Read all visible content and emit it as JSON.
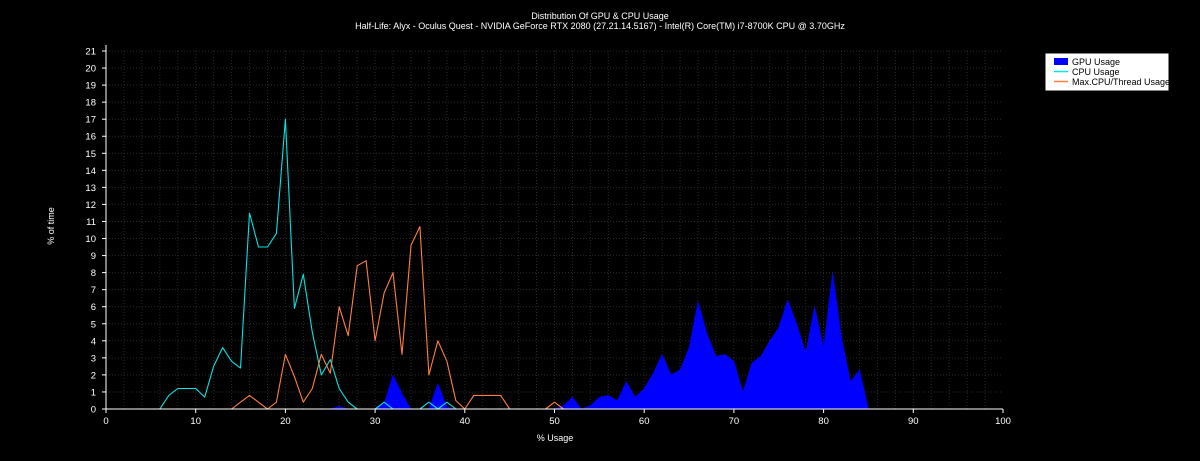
{
  "chart_data": {
    "type": "area",
    "title": "Distribution Of GPU & CPU Usage",
    "subtitle": "Half-Life: Alyx - Oculus Quest - NVIDIA GeForce RTX 2080 (27.21.14.5167) - Intel(R) Core(TM) i7-8700K CPU @ 3.70GHz",
    "xlabel": "% Usage",
    "ylabel": "% of time",
    "xlim": [
      0,
      100
    ],
    "ylim": [
      0,
      21
    ],
    "xticks": [
      "0",
      "10",
      "20",
      "30",
      "40",
      "50",
      "60",
      "70",
      "80",
      "90",
      "100"
    ],
    "yticks": [
      "0",
      "1",
      "2",
      "3",
      "4",
      "5",
      "6",
      "7",
      "8",
      "9",
      "10",
      "11",
      "12",
      "13",
      "14",
      "15",
      "16",
      "17",
      "18",
      "19",
      "20",
      "21"
    ],
    "grid": true,
    "legend_position": "top-right",
    "series": [
      {
        "name": "GPU Usage",
        "kind": "area",
        "color": "#0000ff",
        "x": [
          0,
          25,
          26,
          27,
          28,
          30,
          31,
          32,
          33,
          34,
          35,
          36,
          37,
          38,
          39,
          49,
          50,
          51,
          52,
          53,
          54,
          55,
          56,
          57,
          58,
          59,
          60,
          61,
          62,
          63,
          64,
          65,
          66,
          67,
          68,
          69,
          70,
          71,
          72,
          73,
          74,
          75,
          76,
          77,
          78,
          79,
          80,
          81,
          82,
          83,
          84,
          85,
          86,
          100
        ],
        "y": [
          0,
          0,
          0.15,
          0,
          0,
          0,
          0.3,
          2,
          0.9,
          0,
          0,
          0,
          1.5,
          0.1,
          0,
          0,
          0,
          0.2,
          0.7,
          0,
          0.2,
          0.7,
          0.8,
          0.5,
          1.6,
          0.7,
          1.2,
          2.1,
          3.2,
          2,
          2.3,
          3.6,
          6.3,
          4.4,
          3.1,
          3.2,
          2.8,
          1,
          2.7,
          3.1,
          4,
          4.8,
          6.4,
          5,
          3.3,
          6,
          3.6,
          8,
          4.2,
          1.6,
          2.3,
          0,
          0,
          0
        ]
      },
      {
        "name": "CPU Usage",
        "kind": "line",
        "color": "#00e5e5",
        "x": [
          0,
          6,
          7,
          8,
          9,
          10,
          11,
          12,
          13,
          14,
          15,
          16,
          17,
          18,
          19,
          20,
          21,
          22,
          23,
          24,
          25,
          26,
          27,
          28,
          29,
          30,
          31,
          32,
          33,
          34,
          35,
          36,
          37,
          38,
          39,
          40,
          100
        ],
        "y": [
          0,
          0,
          0.8,
          1.2,
          1.2,
          1.2,
          0.7,
          2.5,
          3.6,
          2.8,
          2.4,
          11.5,
          9.5,
          9.5,
          10.3,
          17,
          5.9,
          7.9,
          4.5,
          2,
          2.9,
          1.2,
          0.4,
          0,
          0,
          0,
          0.4,
          0,
          0,
          0,
          0,
          0.4,
          0,
          0.4,
          0,
          0,
          0
        ]
      },
      {
        "name": "Max.CPU/Thread Usage",
        "kind": "line",
        "color": "#ff7f3f",
        "x": [
          0,
          14,
          15,
          16,
          17,
          18,
          19,
          20,
          21,
          22,
          23,
          24,
          25,
          26,
          27,
          28,
          29,
          30,
          31,
          32,
          33,
          34,
          35,
          36,
          37,
          38,
          39,
          40,
          41,
          42,
          43,
          44,
          45,
          46,
          47,
          48,
          49,
          50,
          51,
          52,
          100
        ],
        "y": [
          0,
          0,
          0.4,
          0.8,
          0.4,
          0,
          0.4,
          3.2,
          1.9,
          0.4,
          1.2,
          3.2,
          2.1,
          6,
          4.3,
          8.4,
          8.7,
          4,
          6.8,
          8,
          3.2,
          9.6,
          10.7,
          2,
          4,
          2.8,
          0.5,
          0,
          0.8,
          0.8,
          0.8,
          0.8,
          0,
          0,
          0,
          0,
          0,
          0.4,
          0,
          0,
          0
        ]
      }
    ]
  }
}
